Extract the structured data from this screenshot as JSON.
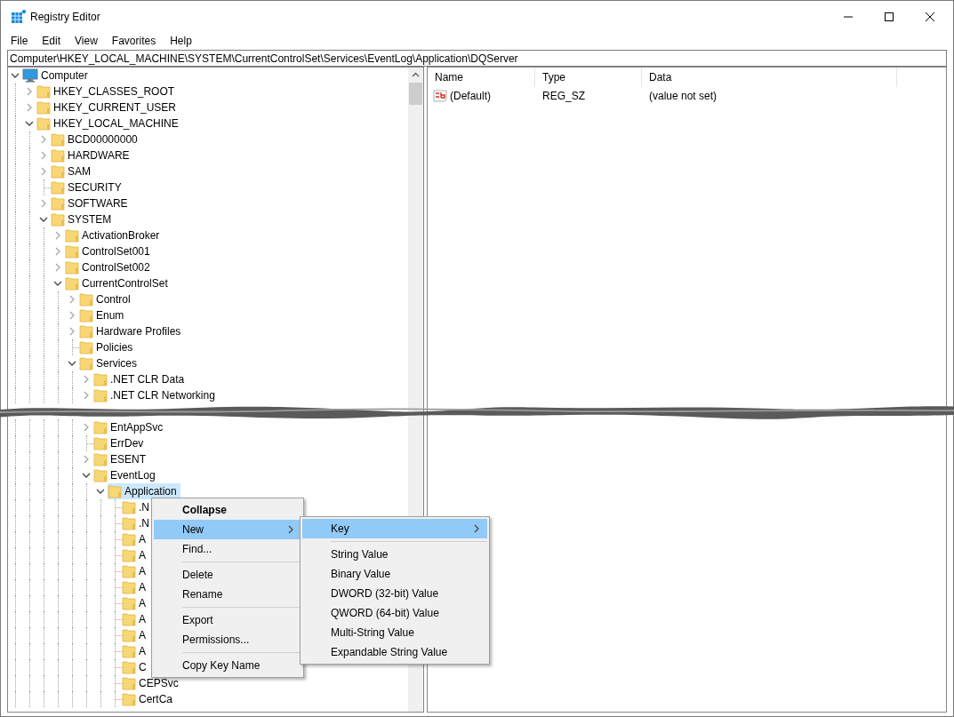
{
  "window": {
    "title": "Registry Editor"
  },
  "menu_bar": [
    "File",
    "Edit",
    "View",
    "Favorites",
    "Help"
  ],
  "address": "Computer\\HKEY_LOCAL_MACHINE\\SYSTEM\\CurrentControlSet\\Services\\EventLog\\Application\\DQServer",
  "tree": [
    {
      "label": "Computer",
      "kind": "computer",
      "expanded": true,
      "selected": false,
      "children": [
        {
          "label": "HKEY_CLASSES_ROOT",
          "kind": "branch",
          "expanded": false,
          "selected": false
        },
        {
          "label": "HKEY_CURRENT_USER",
          "kind": "branch",
          "expanded": false,
          "selected": false
        },
        {
          "label": "HKEY_LOCAL_MACHINE",
          "kind": "branch",
          "expanded": true,
          "selected": false,
          "children": [
            {
              "label": "BCD00000000",
              "kind": "branch",
              "expanded": false,
              "selected": false
            },
            {
              "label": "HARDWARE",
              "kind": "branch",
              "expanded": false,
              "selected": false
            },
            {
              "label": "SAM",
              "kind": "branch",
              "expanded": false,
              "selected": false
            },
            {
              "label": "SECURITY",
              "kind": "leaf",
              "selected": false
            },
            {
              "label": "SOFTWARE",
              "kind": "branch",
              "expanded": false,
              "selected": false
            },
            {
              "label": "SYSTEM",
              "kind": "branch",
              "expanded": true,
              "selected": false,
              "children": [
                {
                  "label": "ActivationBroker",
                  "kind": "branch",
                  "expanded": false,
                  "selected": false
                },
                {
                  "label": "ControlSet001",
                  "kind": "branch",
                  "expanded": false,
                  "selected": false
                },
                {
                  "label": "ControlSet002",
                  "kind": "branch",
                  "expanded": false,
                  "selected": false
                },
                {
                  "label": "CurrentControlSet",
                  "kind": "branch",
                  "expanded": true,
                  "selected": false,
                  "children": [
                    {
                      "label": "Control",
                      "kind": "branch",
                      "expanded": false,
                      "selected": false
                    },
                    {
                      "label": "Enum",
                      "kind": "branch",
                      "expanded": false,
                      "selected": false
                    },
                    {
                      "label": "Hardware Profiles",
                      "kind": "branch",
                      "expanded": false,
                      "selected": false
                    },
                    {
                      "label": "Policies",
                      "kind": "leaf",
                      "selected": false
                    },
                    {
                      "label": "Services",
                      "kind": "branch",
                      "expanded": true,
                      "selected": false,
                      "children": [
                        {
                          "label": ".NET CLR Data",
                          "kind": "branch",
                          "expanded": false,
                          "selected": false
                        },
                        {
                          "label": ".NET CLR Networking",
                          "kind": "branch",
                          "expanded": false,
                          "selected": false
                        },
                        {
                          "label": "EntAppSvc",
                          "kind": "branch",
                          "expanded": false,
                          "selected": false
                        },
                        {
                          "label": "ErrDev",
                          "kind": "leaf",
                          "selected": false
                        },
                        {
                          "label": "ESENT",
                          "kind": "branch",
                          "expanded": false,
                          "selected": false
                        },
                        {
                          "label": "EventLog",
                          "kind": "branch",
                          "expanded": true,
                          "selected": false,
                          "children": [
                            {
                              "label": "Application",
                              "kind": "branch",
                              "expanded": true,
                              "selected": true,
                              "children": [
                                {
                                  "label": ".N",
                                  "kind": "leaf",
                                  "selected": false
                                },
                                {
                                  "label": ".N",
                                  "kind": "leaf",
                                  "selected": false
                                },
                                {
                                  "label": "A",
                                  "kind": "leaf",
                                  "selected": false
                                },
                                {
                                  "label": "A",
                                  "kind": "leaf",
                                  "selected": false
                                },
                                {
                                  "label": "A",
                                  "kind": "leaf",
                                  "selected": false
                                },
                                {
                                  "label": "A",
                                  "kind": "leaf",
                                  "selected": false
                                },
                                {
                                  "label": "A",
                                  "kind": "leaf",
                                  "selected": false
                                },
                                {
                                  "label": "A",
                                  "kind": "leaf",
                                  "selected": false
                                },
                                {
                                  "label": "A",
                                  "kind": "leaf",
                                  "selected": false
                                },
                                {
                                  "label": "A",
                                  "kind": "leaf",
                                  "selected": false
                                },
                                {
                                  "label": "C",
                                  "kind": "leaf",
                                  "selected": false
                                },
                                {
                                  "label": "CEPSvc",
                                  "kind": "leaf",
                                  "selected": false
                                },
                                {
                                  "label": "CertCa",
                                  "kind": "leaf",
                                  "selected": false
                                }
                              ]
                            }
                          ]
                        }
                      ]
                    }
                  ]
                }
              ]
            }
          ]
        }
      ]
    }
  ],
  "values": {
    "columns": [
      "Name",
      "Type",
      "Data"
    ],
    "rows": [
      {
        "name": "(Default)",
        "type": "REG_SZ",
        "data": "(value not set)"
      }
    ]
  },
  "context_menu": [
    {
      "kind": "item",
      "label": "Collapse",
      "default": true,
      "selected": false,
      "submenu": false
    },
    {
      "kind": "item",
      "label": "New",
      "default": false,
      "selected": true,
      "submenu": true
    },
    {
      "kind": "item",
      "label": "Find...",
      "default": false,
      "selected": false,
      "submenu": false
    },
    {
      "kind": "separator"
    },
    {
      "kind": "item",
      "label": "Delete",
      "default": false,
      "selected": false,
      "submenu": false
    },
    {
      "kind": "item",
      "label": "Rename",
      "default": false,
      "selected": false,
      "submenu": false
    },
    {
      "kind": "separator"
    },
    {
      "kind": "item",
      "label": "Export",
      "default": false,
      "selected": false,
      "submenu": false
    },
    {
      "kind": "item",
      "label": "Permissions...",
      "default": false,
      "selected": false,
      "submenu": false
    },
    {
      "kind": "separator"
    },
    {
      "kind": "item",
      "label": "Copy Key Name",
      "default": false,
      "selected": false,
      "submenu": false
    }
  ],
  "submenu": [
    {
      "kind": "item",
      "label": "Key",
      "default": false,
      "selected": true,
      "submenu": true
    },
    {
      "kind": "separator"
    },
    {
      "kind": "item",
      "label": "String Value",
      "default": false,
      "selected": false,
      "submenu": false
    },
    {
      "kind": "item",
      "label": "Binary Value",
      "default": false,
      "selected": false,
      "submenu": false
    },
    {
      "kind": "item",
      "label": "DWORD (32-bit) Value",
      "default": false,
      "selected": false,
      "submenu": false
    },
    {
      "kind": "item",
      "label": "QWORD (64-bit) Value",
      "default": false,
      "selected": false,
      "submenu": false
    },
    {
      "kind": "item",
      "label": "Multi-String Value",
      "default": false,
      "selected": false,
      "submenu": false
    },
    {
      "kind": "item",
      "label": "Expandable String Value",
      "default": false,
      "selected": false,
      "submenu": false
    }
  ]
}
